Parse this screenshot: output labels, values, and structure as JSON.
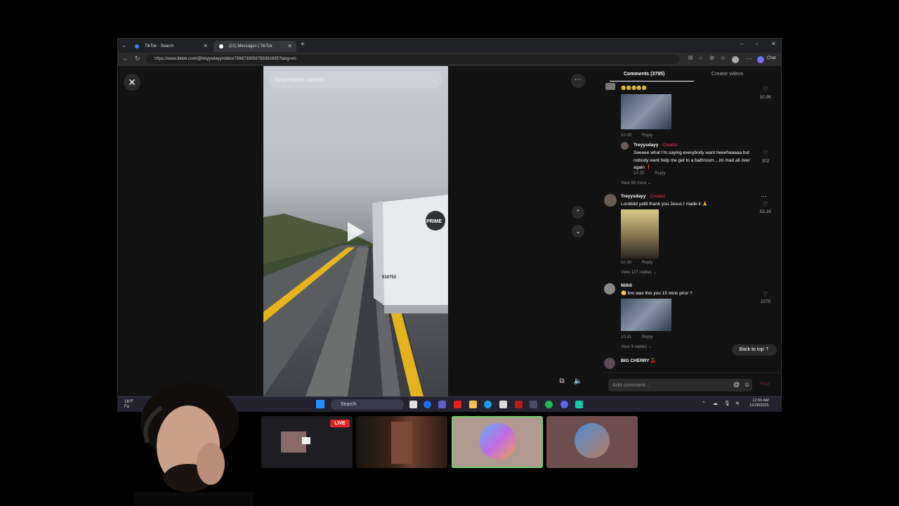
{
  "browser": {
    "tabs": [
      {
        "label": "TikTok - Search"
      },
      {
        "label": "(21) Messages | TikTok"
      }
    ],
    "new_tab": "+",
    "url": "https://www.tiktok.com/@treyysdayy/video/7566739056789392695?lang=en",
    "chat_label": "Chat"
  },
  "video": {
    "search_placeholder": "Find related content",
    "truck_number": "010753"
  },
  "panel": {
    "tab_comments": "Comments (3795)",
    "tab_creator": "Creator videos",
    "comments": [
      {
        "emojis": "🥺🥺🥺🥺🥺",
        "date": "10-30",
        "reply": "Reply",
        "likes": "10.9K"
      },
      {
        "name": "Treyysdayy",
        "badge": "· Creator",
        "text": "Seeeee what I'm saying everybody want heeehaaaaa but nobody want help me get to a bathroom....im mad all over again ❗",
        "date": "10-30",
        "reply": "Reply",
        "likes": "302",
        "more": "View 83 more ⌄"
      },
      {
        "name": "Treyysdayy",
        "badge": "· Creator",
        "text": "Lordddd yallll thank you Jesus I made it 🙏",
        "date": "10-30",
        "reply": "Reply",
        "likes": "53.1K",
        "more": "View 127 replies ⌄"
      },
      {
        "name": "Niih0",
        "text": "😳 bro was this you 15 mins prior ?",
        "date": "10-31",
        "reply": "Reply",
        "likes": "2270",
        "more": "View 9 replies ⌄"
      },
      {
        "name": "BIG CHERRY 🍒"
      }
    ],
    "back_to_top": "Back to top ⇡",
    "add_comment_placeholder": "Add comment...",
    "post": "Post"
  },
  "taskbar": {
    "weather": "16°F",
    "weather_sub": "Fa",
    "search": "Search",
    "time": "12:09 AM",
    "date": "12/28/2025"
  },
  "overlay": {
    "live_badge": "LIVE"
  },
  "colors": {
    "accent": "#fe2c55",
    "live": "#e02424",
    "taskbar": "#23222e"
  }
}
